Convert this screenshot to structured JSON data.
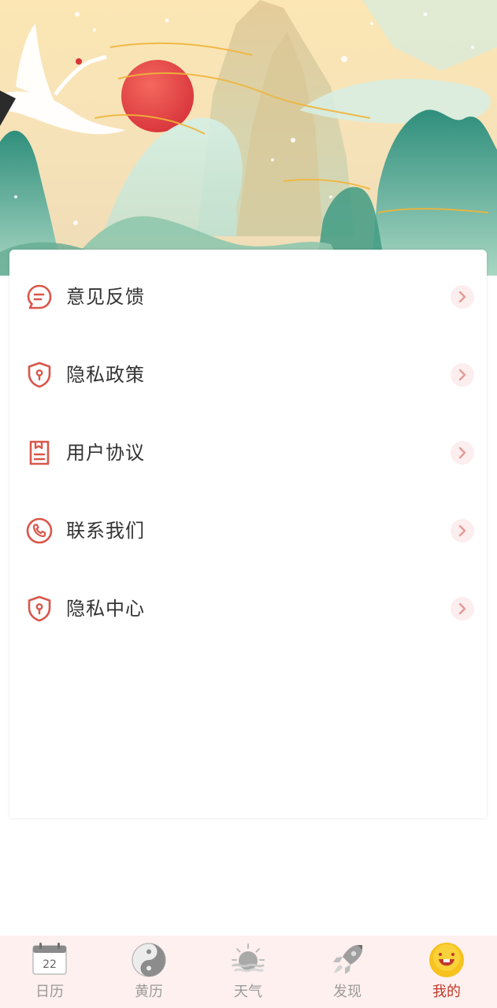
{
  "theme": {
    "accent": "#d9564a",
    "menu_text": "#333333",
    "tab_inactive": "#9a9a9a",
    "tab_active": "#c0392b",
    "tabbar_bg": "#fdf0ee"
  },
  "menu": {
    "items": [
      {
        "label": "意见反馈",
        "icon": "feedback-chat-icon"
      },
      {
        "label": "隐私政策",
        "icon": "privacy-shield-icon"
      },
      {
        "label": "用户协议",
        "icon": "agreement-document-icon"
      },
      {
        "label": "联系我们",
        "icon": "phone-icon"
      },
      {
        "label": "隐私中心",
        "icon": "privacy-shield-icon"
      }
    ]
  },
  "tabs": [
    {
      "label": "日历",
      "icon": "calendar-icon",
      "icon_text": "22",
      "active": false
    },
    {
      "label": "黄历",
      "icon": "yin-yang-icon",
      "active": false
    },
    {
      "label": "天气",
      "icon": "weather-sun-icon",
      "active": false
    },
    {
      "label": "发现",
      "icon": "rocket-icon",
      "active": false
    },
    {
      "label": "我的",
      "icon": "smiley-face-icon",
      "active": true
    }
  ]
}
